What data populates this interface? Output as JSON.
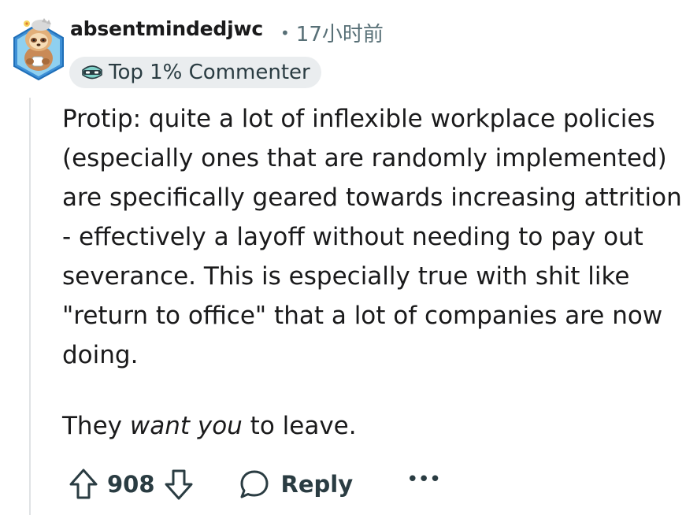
{
  "comment": {
    "username": "absentmindedjwc",
    "separator": "•",
    "time": "17小时前",
    "flair": {
      "icon": "ninja-mask-icon",
      "label": "Top 1% Commenter"
    },
    "paragraph1": "Protip: quite a lot of inflexible workplace policies (especially ones that are randomly implemented) are specifically geared towards increasing attrition - effectively a layoff without needing to pay out severance. This is especially true with shit like \"return to office\" that a lot of companies are now doing.",
    "paragraph2": {
      "before": "They ",
      "emphasis": "want you",
      "after": " to leave."
    }
  },
  "actions": {
    "upvote_icon": "arrow-up-icon",
    "vote_count": "908",
    "downvote_icon": "arrow-down-icon",
    "reply_icon": "speech-bubble-icon",
    "reply_label": "Reply",
    "more_label": "•••"
  },
  "colors": {
    "text": "#1a1a1b",
    "meta": "#576f76",
    "flair_bg": "#eaedef",
    "thread_line": "#e0e3e5"
  }
}
